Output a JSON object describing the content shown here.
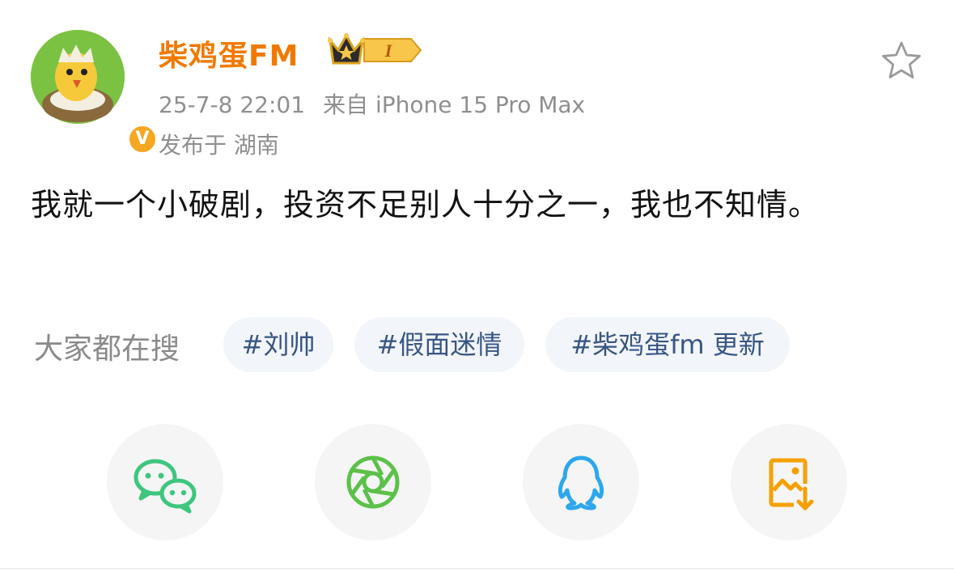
{
  "user": {
    "name": "柴鸡蛋FM",
    "level_badge_text": "I",
    "verified_badge_text": "V",
    "crown_icon": "crown-icon",
    "avatar_icon": "chick-in-eggshell-avatar"
  },
  "meta": {
    "time": "25-7-8 22:01",
    "source": "来自 iPhone 15 Pro Max",
    "location": "发布于 湖南"
  },
  "post": {
    "text": "我就一个小破剧，投资不足别人十分之一，我也不知情。"
  },
  "search": {
    "label": "大家都在搜",
    "tags": [
      "#刘帅",
      "#假面迷情",
      "#柴鸡蛋fm 更新"
    ]
  },
  "share": {
    "items": [
      {
        "name": "wechat",
        "icon": "wechat-icon",
        "color": "#3fc67e"
      },
      {
        "name": "moments",
        "icon": "moments-aperture-icon",
        "color": "#5cc14a"
      },
      {
        "name": "qq",
        "icon": "qq-penguin-icon",
        "color": "#2ea7ec"
      },
      {
        "name": "save-image",
        "icon": "image-download-icon",
        "color": "#f5a000"
      }
    ]
  },
  "colors": {
    "username": "#f07a00",
    "meta": "#8f8f8f",
    "tag_text": "#385684",
    "tag_bg": "#f2f5f9"
  }
}
